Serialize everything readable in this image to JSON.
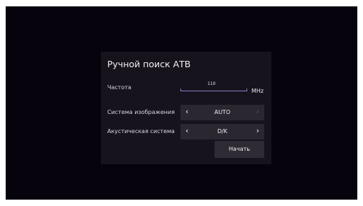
{
  "dialog": {
    "title": "Ручной поиск АТВ",
    "frequency": {
      "label": "Частота",
      "value": "110",
      "unit": "MHz"
    },
    "picture_system": {
      "label": "Система изображения",
      "value": "AUTO",
      "left_arrow": "‹",
      "right_arrow": "›",
      "left_arrow_color": "#f0eef4",
      "right_arrow_color": "#5a5760"
    },
    "sound_system": {
      "label": "Акустическая система",
      "value": "D/K",
      "left_arrow": "‹",
      "right_arrow": "›",
      "left_arrow_color": "#f0eef4",
      "right_arrow_color": "#f0eef4"
    },
    "start_label": "Начать"
  },
  "colors": {
    "screen_bg": "#06030d",
    "dialog_bg": "#16131c",
    "accent_line": "#8a7dd0"
  }
}
